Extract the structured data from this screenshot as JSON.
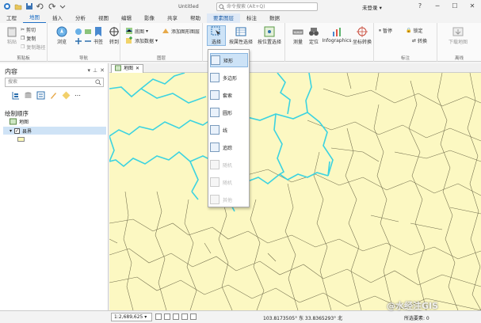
{
  "window": {
    "title": "Untitled",
    "sign_in": "未登录",
    "search_placeholder": "命令搜索 (Alt+Q)"
  },
  "tabs": [
    {
      "label": "工程"
    },
    {
      "label": "地图"
    },
    {
      "label": "插入"
    },
    {
      "label": "分析"
    },
    {
      "label": "视图"
    },
    {
      "label": "编辑"
    },
    {
      "label": "影像"
    },
    {
      "label": "共享"
    },
    {
      "label": "帮助"
    },
    {
      "label": "要素图层"
    },
    {
      "label": "标注"
    },
    {
      "label": "数据"
    }
  ],
  "ribbon": {
    "clipboard": {
      "paste": "粘贴",
      "cut": "剪切",
      "copy": "复制",
      "copy_path": "复制路径",
      "label": "剪贴板"
    },
    "navigate": {
      "explore": "浏览",
      "bookmarks": "书签",
      "go_to": "转到",
      "label": "导航"
    },
    "layer": {
      "basemap": "底图",
      "add_data": "添加数据",
      "add_graphics": "添加图形图层",
      "label": "图层"
    },
    "selection": {
      "select": "选择",
      "by_attributes": "按属性选择",
      "by_location": "按位置选择"
    },
    "inquiry": {
      "measure": "测量",
      "locate": "定位",
      "infographics": "Infographics",
      "coordinate": "坐标转换"
    },
    "labeling": {
      "pause": "暂停",
      "lock": "锁定",
      "convert": "转换",
      "label": "标注"
    },
    "offline": {
      "download": "下载地图",
      "label": "离线"
    }
  },
  "contents": {
    "title": "内容",
    "search_placeholder": "搜索",
    "drawing_order": "绘制顺序",
    "map_name": "地图",
    "layer_name": "县界"
  },
  "map_tab": {
    "label": "地图"
  },
  "select_menu": {
    "items": [
      {
        "label": "矩形",
        "enabled": true,
        "selected": true
      },
      {
        "label": "多边形",
        "enabled": true,
        "selected": false
      },
      {
        "label": "套索",
        "enabled": true,
        "selected": false
      },
      {
        "label": "圆形",
        "enabled": true,
        "selected": false
      },
      {
        "label": "线",
        "enabled": true,
        "selected": false
      },
      {
        "label": "追踪",
        "enabled": true,
        "selected": false
      },
      {
        "label": "随机",
        "enabled": false,
        "selected": false
      },
      {
        "label": "随机",
        "enabled": false,
        "selected": false
      },
      {
        "label": "其他",
        "enabled": false,
        "selected": false
      }
    ]
  },
  "status": {
    "scale": "1:2,689,625",
    "coords": "103.8173505° 东 33.8365293° 北",
    "selected": "所选要素: 0"
  },
  "watermark": "@水经注GIS",
  "colors": {
    "accent": "#1f6fc5",
    "map_fill": "#fcf8c2",
    "boundary": "#3cd3e0",
    "county_line": "#6e6a4a"
  }
}
